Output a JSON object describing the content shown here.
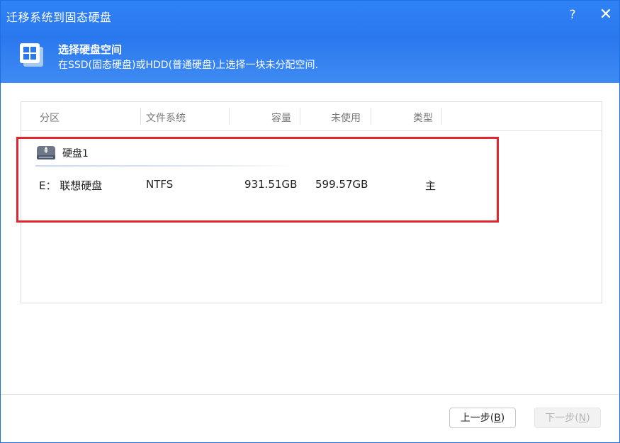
{
  "window": {
    "title": "迁移系统到固态硬盘",
    "help_label": "?",
    "close_label": "✕"
  },
  "step": {
    "title": "选择硬盘空间",
    "subtitle": "在SSD(固态硬盘)或HDD(普通硬盘)上选择一块未分配空间.",
    "icon": "windows-logo-icon"
  },
  "table": {
    "columns": [
      "分区",
      "文件系统",
      "容量",
      "未使用",
      "类型"
    ],
    "disk": {
      "label": "硬盘1",
      "icon": "hard-disk-icon"
    },
    "partition": {
      "name": "E： 联想硬盘",
      "filesystem": "NTFS",
      "capacity": "931.51GB",
      "unused": "599.57GB",
      "type": "主"
    }
  },
  "footer": {
    "prev_text": "上一步(",
    "prev_key": "B",
    "prev_end": ")",
    "next_text": "下一步(",
    "next_key": "N",
    "next_end": ")"
  },
  "colors": {
    "header_blue": "#2f82f5",
    "highlight_red": "#e0262f"
  }
}
